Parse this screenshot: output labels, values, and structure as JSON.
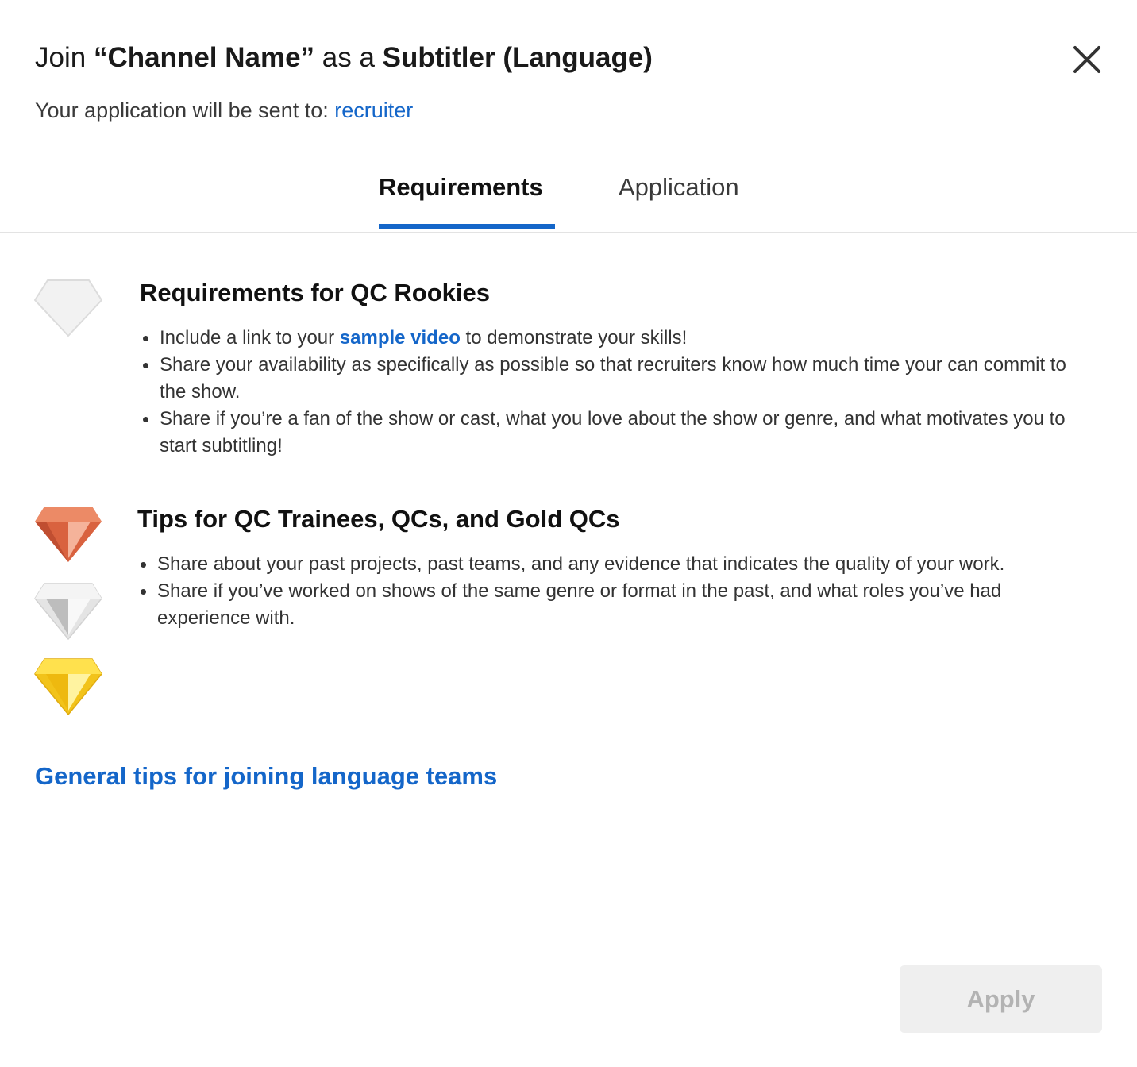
{
  "header": {
    "title_prefix": "Join ",
    "channel_name": "“Channel Name”",
    "title_middle": " as a ",
    "role": "Subtitler (Language)",
    "subtitle_prefix": "Your application will be sent to: ",
    "recipient": "recruiter"
  },
  "tabs": [
    {
      "label": "Requirements",
      "active": true
    },
    {
      "label": "Application",
      "active": false
    }
  ],
  "sections": {
    "rookies": {
      "title": "Requirements for QC Rookies",
      "bullet1_prefix": "Include a link to your ",
      "bullet1_link": "sample video",
      "bullet1_suffix": " to demonstrate your skills!",
      "bullet2": "Share your availability as specifically as possible so that recruiters know how much time your can commit to the show.",
      "bullet3": "Share if you’re a fan of the show or cast, what you love about the show or genre, and what motivates you to start subtitling!",
      "icon": "silver-diamond-icon"
    },
    "trainees": {
      "title": "Tips for QC Trainees, QCs, and Gold QCs",
      "bullet1": "Share about your past projects, past teams, and any evidence that indicates the quality of your work.",
      "bullet2": "Share if you’ve worked on shows of the same genre or format in the past, and what roles you’ve had experience with.",
      "icons": [
        "bronze-gem-icon",
        "silver-gem-icon",
        "gold-gem-icon"
      ]
    }
  },
  "general_tips_link": "General tips for joining language teams",
  "footer": {
    "apply_label": "Apply",
    "apply_disabled": true
  },
  "colors": {
    "accent": "#1466c9",
    "disabled_bg": "#efefef",
    "disabled_text": "#b3b3b3"
  }
}
